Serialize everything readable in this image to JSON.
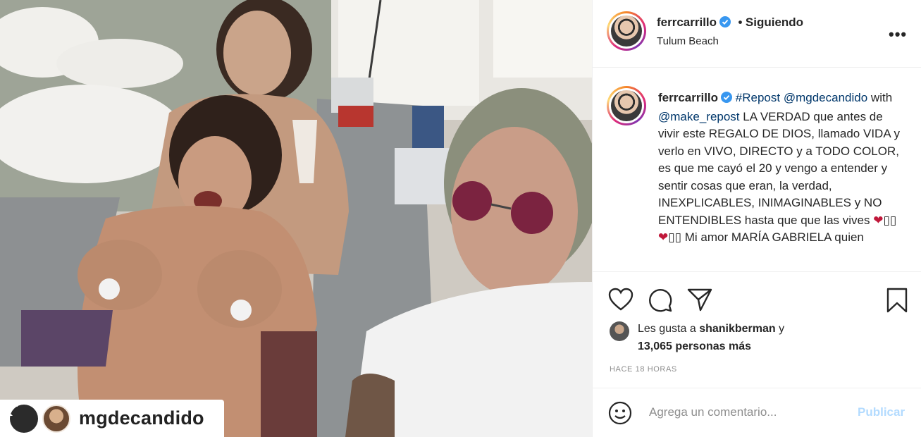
{
  "post": {
    "username": "ferrcarrillo",
    "follow_status": "Siguiendo",
    "separator": "•",
    "location": "Tulum Beach",
    "more_label": "•••"
  },
  "photo": {
    "repost_username": "mgdecandido"
  },
  "caption": {
    "username": "ferrcarrillo",
    "hashtag": "#Repost",
    "mention_source": "@mgdecandido",
    "with_text": "with",
    "mention_app": "@make_repost",
    "body": "LA VERDAD que antes de vivir este REGALO DE DIOS, llamado VIDA y verlo en VIVO, DIRECTO y a TODO COLOR, es que me cayó el 20 y vengo a entender y sentir cosas que eran, la verdad, INEXPLICABLES, INIMAGINABLES y NO ENTENDIBLES hasta que que las vives",
    "hearts": "❤",
    "boxes": "▯▯",
    "trail": "Mi",
    "cut_line": "amor MARÍA GABRIELA quien"
  },
  "likes": {
    "prefix": "Les gusta a",
    "first_user": "shanikberman",
    "conjunction": "y",
    "count_text": "13,065 personas más"
  },
  "timestamp": "HACE 18 HORAS",
  "comment": {
    "placeholder": "Agrega un comentario...",
    "publish_label": "Publicar"
  },
  "icons": {
    "like": "heart-outline-icon",
    "comment": "speech-bubble-icon",
    "share": "paper-plane-icon",
    "save": "bookmark-icon",
    "emoji": "smiley-icon",
    "verified": "verified-badge-icon"
  },
  "colors": {
    "verified_blue": "#3897f0",
    "link_blue": "#00376b",
    "publish_disabled": "#b3dbff",
    "muted_text": "#8e8e8e"
  }
}
